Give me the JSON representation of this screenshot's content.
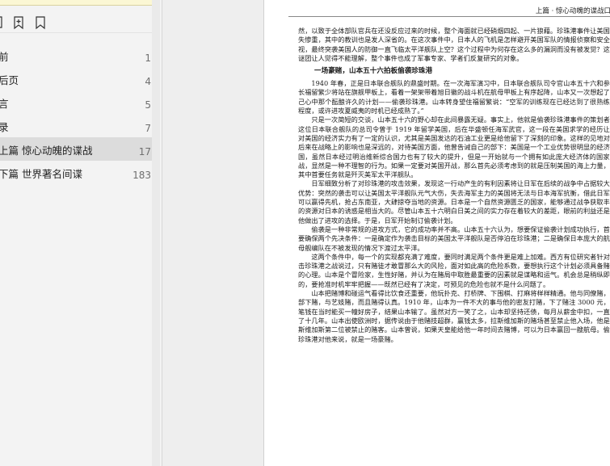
{
  "sidebar": {
    "toc": [
      {
        "title": "前",
        "page": "1"
      },
      {
        "title": "后页",
        "page": "4"
      },
      {
        "title": "言",
        "page": "5"
      },
      {
        "title": "录",
        "page": "7"
      },
      {
        "title": "上篇  惊心动魄的谍战",
        "page": "17"
      },
      {
        "title": "下篇  世界著名间谍",
        "page": "183"
      }
    ]
  },
  "page": {
    "running_head": "上篇 · 惊心动魄的谍战口",
    "para1": "然，以致于全体部队官兵在还没反应过来的时候，整个海面就已经硝烟四起、一片狼藉。珍珠港事件让美国损失惨重，其中的教训也是发人深省的。在这次事件中，日本人的飞机是怎样避开美国军队的情报侦察和安全监视，最终突袭美国人的防御一直飞临太平洋舰队上空？这个过程中为何存在这么多的漏洞而没有被发觉？这些谜团让人觉得不能理解，整个事件也成了军事专家、学者们反复研究的对象。",
    "heading": "一场豪赌，山本五十六拍板偷袭珍珠港",
    "para2": "1940 年春，正是日本联合舰队的鼎盛时期。在一次海军演习中，日本联合舰队司令官山本五十六和参谋长福留繁少将站在旗舰甲板上，看着一架架带着旭日徽的战斗机在航母甲板上有序起降，山本又一次想起了自己心中那个酝酿许久的计划——偷袭珍珠港。山本转身望住福留繁说：“空军的训练现在已经达到了很熟练的程度，或许进攻夏威夷的时机已经成熟了。”",
    "para3": "只是一次简短的交谈，山本五十六的野心却在此间暴露无疑。事实上，他就是偷袭珍珠港事件的策划者。这位日本联合舰队的总司令曾于 1919 年留学美国，后在华盛顿任海军武官，这一段在美国求学的经历让他对美国的经济实力有了一定的认识，尤其是美国发达的石油工业更是给他留下了深刻的印象。这样的见地对他后来在战略上的影响也是深远的，对待美国方面，他曾告诫自己的部下：美国是一个工业优势很明显的经济强国，虽然日本经过明治维新综合国力也有了较大的提升，但是一开始就与一个拥有如此庞大经济体的国家开战，显然是一种不理智的行为。如果一定要对美国开战，那么首先必须考虑到的就是压制美国的海上力量，这其中首要任务就是歼灭美军太平洋舰队。",
    "para4": "日军细致分析了对珍珠港的攻击效果，发现这一行动产生的有利因素将让日军在后续的战争中占据较大的优势：突然的袭击可以让美国太平洋舰队元气大伤，失去海军主力的美国将无法与日本海军抗衡，借此日军就可以赢得先机，抢占东南亚，大肆掠夺当地的资源。日本是一个自然资源匮乏的国家，能够通过战争获取丰富的资源对日本的诱惑是相当大的。尽管山本五十六明白日美之间的实力存在着较大的差距，眼前的利益还是让他做出了进攻的选择。于是，日军开始制订偷袭计划。",
    "para5": "偷袭是一种非常规的进攻方式，它的成功率并不高。山本五十六认为，想要保证偷袭计划成功执行，首先要确保两个先决条件：一是确定作为袭击目标的美国太平洋舰队是否停泊在珍珠港；二是确保日本庞大的航空母舰编队在不被发现的情况下渡过太平洋。",
    "para6": "这两个条件中，每一个的实现都充满了难度，要同时满足两个条件更是难上加难。西方有位研究者针对袭击珍珠港之战说过，只有赌徒才敢冒那么大的风险，面对如此高的危险系数，要想执行这个计划必须具备赌博的心理。山本是个冒险家，生性好赌，并认为在赌局中取胜最重要的因素就是谋略和运气。机会总是稍纵即逝的，要抢准时机牢牢把握——既然已经有了决定，可预见的危险也就不是什么问题了。",
    "para7": "山本把赌博和碰运气看得比饮食还重要，他玩扑克、打桥牌、下围棋、打麻将样样精通。他与同僚赌，与部下赌，与艺妓赌，而且赌得认真。1910 年，山本为一件不大的事与他的密友打赌，下了赌注 3000 元，这笔钱在当时能买一幢好房子，结果山本输了。虽然对方一笑了之，山本却坚持还债，每月从薪金中扣，一直扣了十几年。山本出使欧洲时，据传说由于他赌技超群，赢钱太多，拉斯维加斯的赌场甚至禁止他入场，他是拉斯维加斯第二位被禁止的赌客。山本曾说，如果天皇能给他一年时间去赌博，可以为日本赢回一艘航母。偷袭珍珠港对他来说，就是一场豪赌。"
  }
}
